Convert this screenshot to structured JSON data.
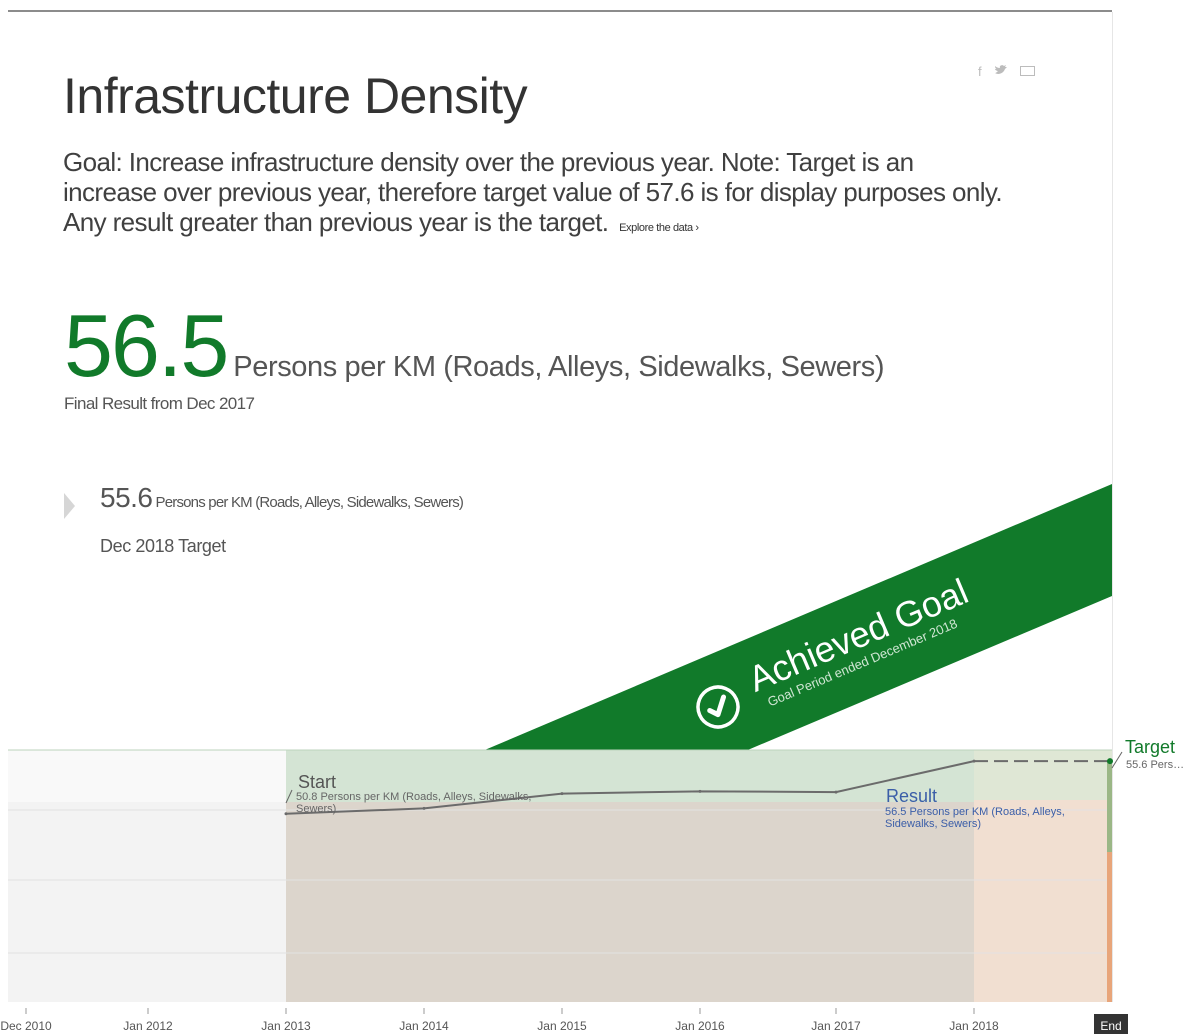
{
  "header": {
    "title": "Infrastructure Density",
    "goal_text": "Goal: Increase infrastructure density over the previous year. Note: Target is an increase over previous year, therefore target value of 57.6 is for display purposes only. Any result greater than previous year is the target.",
    "explore_link": "Explore the data ›"
  },
  "share": {
    "facebook": "f",
    "twitter": "t",
    "email": "email"
  },
  "result": {
    "value": "56.5",
    "unit": "Persons per KM (Roads, Alleys, Sidewalks, Sewers)",
    "note": "Final Result from Dec 2017"
  },
  "target": {
    "value": "55.6",
    "unit": "Persons per KM (Roads, Alleys, Sidewalks, Sewers)",
    "label": "Dec 2018 Target"
  },
  "ribbon": {
    "title": "Achieved Goal",
    "subtitle": "Goal Period ended December 2018",
    "color": "#117a2a"
  },
  "chart_data": {
    "type": "line",
    "x_ticks": [
      "Dec 2010",
      "Jan 2012",
      "Jan 2013",
      "Jan 2014",
      "Jan 2015",
      "Jan 2016",
      "Jan 2017",
      "Jan 2018"
    ],
    "end_label": "End",
    "series": [
      {
        "name": "Result",
        "x": [
          "Jan 2013",
          "Jan 2014",
          "Jan 2015",
          "Jan 2016",
          "Jan 2017",
          "Jan 2018",
          "Dec 2018"
        ],
        "values": [
          50.8,
          51.5,
          53.4,
          53.7,
          53.6,
          57.6,
          57.6
        ]
      }
    ],
    "annotations": {
      "start": {
        "title": "Start",
        "text": "50.8 Persons per KM (Roads, Alleys, Sidewalks, Sewers)"
      },
      "result": {
        "title": "Result",
        "text": "56.5 Persons per KM (Roads, Alleys, Sidewalks, Sewers)"
      },
      "target": {
        "title": "Target",
        "text": "55.6 Pers…"
      }
    },
    "colors": {
      "green": "#117a2a",
      "line": "#6b6b6b",
      "target_band": "#f2c9a8"
    }
  }
}
